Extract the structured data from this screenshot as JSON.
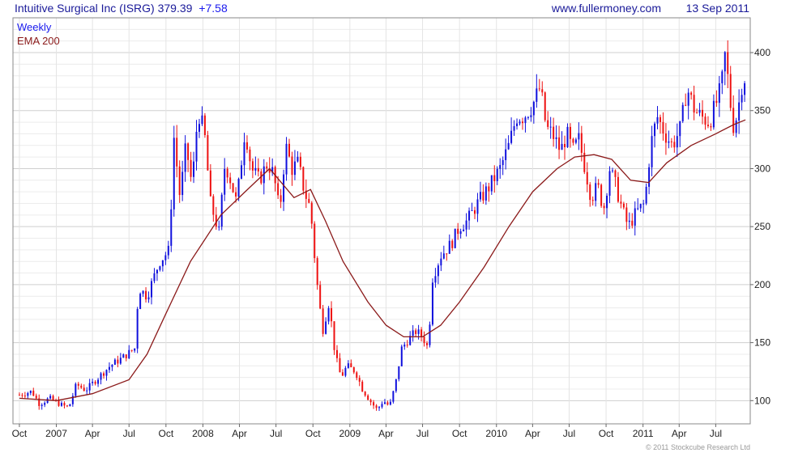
{
  "header": {
    "title": "Intuitive Surgical Inc (ISRG) 379.39",
    "change": "+7.58",
    "website": "www.fullermoney.com",
    "date": "13 Sep 2011"
  },
  "legend": {
    "weekly": "Weekly",
    "ema": "EMA 200"
  },
  "footer": {
    "copyright": "© 2011 Stockcube Research Ltd"
  },
  "colors": {
    "up": "#1010dd",
    "down": "#ee1111",
    "ema": "#8b1a1a",
    "grid": "#dcdcdc",
    "title": "#1a1a99",
    "change": "#1a1aee",
    "legend_weekly": "#1a1aee"
  },
  "chart_data": {
    "type": "candlestick",
    "timeframe": "weekly",
    "ylim": [
      80,
      430
    ],
    "y_ticks": [
      100,
      150,
      200,
      250,
      300,
      350,
      400
    ],
    "x_ticks": [
      {
        "label": "Oct",
        "date": "2006-10-01"
      },
      {
        "label": "2007",
        "date": "2007-01-01"
      },
      {
        "label": "Apr",
        "date": "2007-04-01"
      },
      {
        "label": "Jul",
        "date": "2007-07-01"
      },
      {
        "label": "Oct",
        "date": "2007-10-01"
      },
      {
        "label": "2008",
        "date": "2008-01-01"
      },
      {
        "label": "Apr",
        "date": "2008-04-01"
      },
      {
        "label": "Jul",
        "date": "2008-07-01"
      },
      {
        "label": "Oct",
        "date": "2008-10-01"
      },
      {
        "label": "2009",
        "date": "2009-01-01"
      },
      {
        "label": "Apr",
        "date": "2009-04-01"
      },
      {
        "label": "Jul",
        "date": "2009-07-01"
      },
      {
        "label": "Oct",
        "date": "2009-10-01"
      },
      {
        "label": "2010",
        "date": "2010-01-01"
      },
      {
        "label": "Apr",
        "date": "2010-04-01"
      },
      {
        "label": "Jul",
        "date": "2010-07-01"
      },
      {
        "label": "Oct",
        "date": "2010-10-01"
      },
      {
        "label": "2011",
        "date": "2011-01-01"
      },
      {
        "label": "Apr",
        "date": "2011-04-01"
      },
      {
        "label": "Jul",
        "date": "2011-07-01"
      }
    ],
    "close_path": [
      [
        "2006-10-01",
        105
      ],
      [
        "2006-11-01",
        108
      ],
      [
        "2006-11-20",
        97
      ],
      [
        "2006-12-15",
        102
      ],
      [
        "2007-01-15",
        96
      ],
      [
        "2007-02-01",
        94
      ],
      [
        "2007-02-20",
        114
      ],
      [
        "2007-03-15",
        109
      ],
      [
        "2007-04-10",
        118
      ],
      [
        "2007-05-15",
        130
      ],
      [
        "2007-06-15",
        137
      ],
      [
        "2007-07-15",
        145
      ],
      [
        "2007-07-25",
        197
      ],
      [
        "2007-08-15",
        190
      ],
      [
        "2007-09-15",
        220
      ],
      [
        "2007-10-10",
        230
      ],
      [
        "2007-10-20",
        330
      ],
      [
        "2007-11-05",
        275
      ],
      [
        "2007-11-20",
        320
      ],
      [
        "2007-12-05",
        285
      ],
      [
        "2007-12-20",
        350
      ],
      [
        "2008-01-05",
        330
      ],
      [
        "2008-01-20",
        270
      ],
      [
        "2008-02-10",
        245
      ],
      [
        "2008-02-25",
        305
      ],
      [
        "2008-03-10",
        290
      ],
      [
        "2008-03-25",
        270
      ],
      [
        "2008-04-15",
        335
      ],
      [
        "2008-05-01",
        300
      ],
      [
        "2008-05-20",
        290
      ],
      [
        "2008-06-10",
        305
      ],
      [
        "2008-06-25",
        295
      ],
      [
        "2008-07-10",
        262
      ],
      [
        "2008-07-25",
        320
      ],
      [
        "2008-08-10",
        300
      ],
      [
        "2008-08-25",
        305
      ],
      [
        "2008-09-10",
        280
      ],
      [
        "2008-09-25",
        265
      ],
      [
        "2008-10-10",
        205
      ],
      [
        "2008-10-25",
        160
      ],
      [
        "2008-11-10",
        185
      ],
      [
        "2008-11-25",
        140
      ],
      [
        "2008-12-10",
        120
      ],
      [
        "2008-12-25",
        130
      ],
      [
        "2009-01-15",
        125
      ],
      [
        "2009-02-01",
        110
      ],
      [
        "2009-02-20",
        100
      ],
      [
        "2009-03-10",
        92
      ],
      [
        "2009-03-25",
        100
      ],
      [
        "2009-04-10",
        95
      ],
      [
        "2009-04-25",
        115
      ],
      [
        "2009-05-10",
        145
      ],
      [
        "2009-05-25",
        152
      ],
      [
        "2009-06-15",
        160
      ],
      [
        "2009-07-01",
        155
      ],
      [
        "2009-07-15",
        145
      ],
      [
        "2009-07-25",
        205
      ],
      [
        "2009-08-15",
        225
      ],
      [
        "2009-09-10",
        235
      ],
      [
        "2009-10-01",
        250
      ],
      [
        "2009-10-20",
        255
      ],
      [
        "2009-11-15",
        270
      ],
      [
        "2009-12-15",
        285
      ],
      [
        "2010-01-10",
        300
      ],
      [
        "2010-02-01",
        320
      ],
      [
        "2010-02-20",
        345
      ],
      [
        "2010-03-10",
        345
      ],
      [
        "2010-04-01",
        355
      ],
      [
        "2010-04-20",
        370
      ],
      [
        "2010-05-05",
        335
      ],
      [
        "2010-05-20",
        330
      ],
      [
        "2010-06-10",
        315
      ],
      [
        "2010-06-25",
        330
      ],
      [
        "2010-07-10",
        315
      ],
      [
        "2010-07-25",
        325
      ],
      [
        "2010-08-10",
        300
      ],
      [
        "2010-08-25",
        275
      ],
      [
        "2010-09-10",
        285
      ],
      [
        "2010-09-25",
        265
      ],
      [
        "2010-10-10",
        300
      ],
      [
        "2010-10-25",
        285
      ],
      [
        "2010-11-10",
        265
      ],
      [
        "2010-11-25",
        250
      ],
      [
        "2010-12-15",
        262
      ],
      [
        "2011-01-05",
        270
      ],
      [
        "2011-01-20",
        320
      ],
      [
        "2011-02-05",
        345
      ],
      [
        "2011-02-25",
        330
      ],
      [
        "2011-03-15",
        320
      ],
      [
        "2011-04-05",
        335
      ],
      [
        "2011-04-20",
        370
      ],
      [
        "2011-05-10",
        350
      ],
      [
        "2011-05-25",
        345
      ],
      [
        "2011-06-15",
        340
      ],
      [
        "2011-07-01",
        355
      ],
      [
        "2011-07-15",
        370
      ],
      [
        "2011-07-25",
        400
      ],
      [
        "2011-08-05",
        360
      ],
      [
        "2011-08-15",
        335
      ],
      [
        "2011-08-25",
        350
      ],
      [
        "2011-09-05",
        375
      ],
      [
        "2011-09-13",
        379.39
      ]
    ],
    "ema_200": [
      [
        "2006-10-01",
        102
      ],
      [
        "2007-01-01",
        100
      ],
      [
        "2007-04-01",
        106
      ],
      [
        "2007-07-01",
        118
      ],
      [
        "2007-08-15",
        140
      ],
      [
        "2007-10-01",
        175
      ],
      [
        "2007-12-01",
        220
      ],
      [
        "2008-02-15",
        260
      ],
      [
        "2008-04-15",
        280
      ],
      [
        "2008-06-15",
        300
      ],
      [
        "2008-08-15",
        275
      ],
      [
        "2008-09-25",
        282
      ],
      [
        "2008-11-01",
        255
      ],
      [
        "2008-12-15",
        220
      ],
      [
        "2009-02-15",
        185
      ],
      [
        "2009-04-01",
        165
      ],
      [
        "2009-05-15",
        155
      ],
      [
        "2009-07-01",
        155
      ],
      [
        "2009-08-15",
        165
      ],
      [
        "2009-10-01",
        185
      ],
      [
        "2009-12-01",
        215
      ],
      [
        "2010-02-01",
        250
      ],
      [
        "2010-04-01",
        280
      ],
      [
        "2010-06-01",
        300
      ],
      [
        "2010-07-15",
        310
      ],
      [
        "2010-09-01",
        312
      ],
      [
        "2010-10-15",
        308
      ],
      [
        "2010-12-01",
        290
      ],
      [
        "2011-01-15",
        288
      ],
      [
        "2011-03-01",
        305
      ],
      [
        "2011-05-01",
        320
      ],
      [
        "2011-07-01",
        330
      ],
      [
        "2011-08-15",
        338
      ],
      [
        "2011-09-13",
        342
      ]
    ]
  }
}
